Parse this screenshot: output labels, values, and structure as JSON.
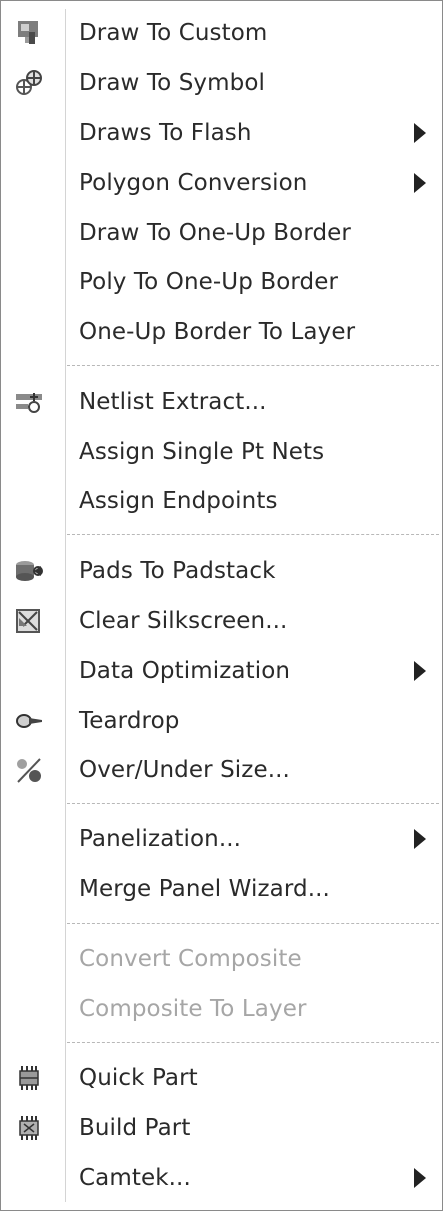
{
  "menu": {
    "items": [
      {
        "label": "Draw To Custom",
        "icon": "draw-to-custom-icon"
      },
      {
        "label": "Draw To Symbol",
        "icon": "draw-to-symbol-icon"
      },
      {
        "label": "Draws To Flash",
        "submenu": true
      },
      {
        "label": "Polygon Conversion",
        "submenu": true
      },
      {
        "label": "Draw To One-Up Border"
      },
      {
        "label": "Poly To One-Up Border"
      },
      {
        "label": "One-Up Border To Layer"
      },
      {
        "label": "Netlist Extract...",
        "icon": "netlist-extract-icon"
      },
      {
        "label": "Assign Single Pt Nets"
      },
      {
        "label": "Assign Endpoints"
      },
      {
        "label": "Pads To Padstack",
        "icon": "pads-to-padstack-icon"
      },
      {
        "label": "Clear Silkscreen...",
        "icon": "clear-silkscreen-icon"
      },
      {
        "label": "Data Optimization",
        "submenu": true
      },
      {
        "label": "Teardrop",
        "icon": "teardrop-icon"
      },
      {
        "label": "Over/Under Size...",
        "icon": "over-under-size-icon"
      },
      {
        "label": "Panelization...",
        "submenu": true
      },
      {
        "label": "Merge Panel Wizard..."
      },
      {
        "label": "Convert Composite",
        "disabled": true
      },
      {
        "label": "Composite To Layer",
        "disabled": true
      },
      {
        "label": "Quick Part",
        "icon": "quick-part-icon"
      },
      {
        "label": "Build Part",
        "icon": "build-part-icon"
      },
      {
        "label": "Camtek...",
        "submenu": true
      }
    ]
  }
}
